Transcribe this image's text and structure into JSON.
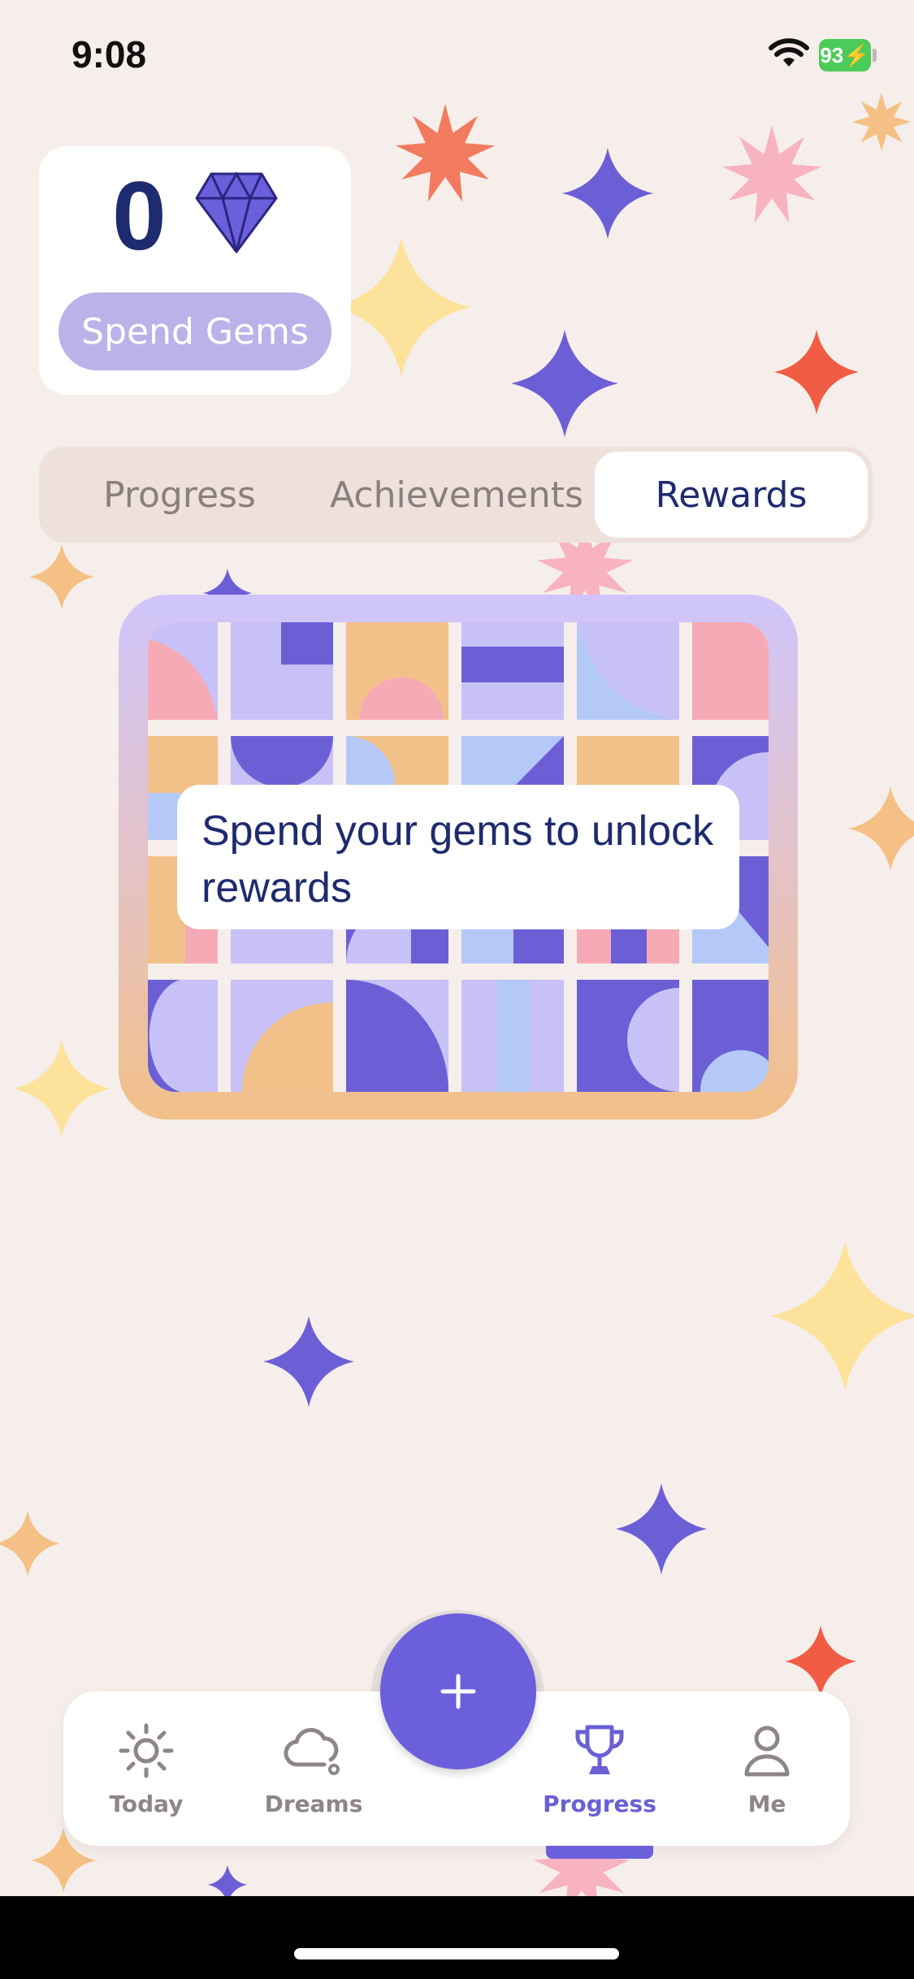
{
  "status_bar": {
    "time": "9:08",
    "battery": "93"
  },
  "gems": {
    "count": "0",
    "spend_label": "Spend Gems"
  },
  "segments": [
    {
      "label": "Progress",
      "selected": false
    },
    {
      "label": "Achievements",
      "selected": false
    },
    {
      "label": "Rewards",
      "selected": true
    }
  ],
  "rewards": {
    "message": "Spend your gems to unlock rewards"
  },
  "tab_bar": {
    "items": [
      {
        "label": "Today",
        "icon": "sun-icon"
      },
      {
        "label": "Dreams",
        "icon": "cloud-icon"
      },
      {
        "label": "Progress",
        "icon": "trophy-icon",
        "active": true
      },
      {
        "label": "Me",
        "icon": "person-icon"
      }
    ],
    "add_icon": "plus-icon"
  },
  "colors": {
    "background": "#f5eeea",
    "accent": "#6c5fdc",
    "navy_text": "#1e2b6e",
    "spend_button": "#b9b3ea"
  }
}
